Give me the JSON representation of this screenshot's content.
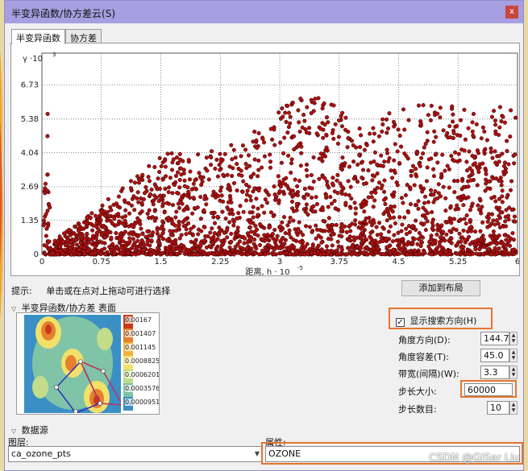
{
  "dialog": {
    "title": "半变异函数/协方差云(S)",
    "close_glyph": "x",
    "tabs": [
      "半变异函数",
      "协方差"
    ]
  },
  "chart_data": {
    "type": "scatter",
    "title": "",
    "y_axis_label": "γ ·10",
    "y_axis_exponent": "3",
    "x_axis_label": "距离, h · 10",
    "x_axis_exponent": "-5",
    "x_ticks": [
      "0",
      "0.75",
      "1.5",
      "2.25",
      "3",
      "3.75",
      "4.5",
      "5.25",
      "6"
    ],
    "y_ticks": [
      "0",
      "1.35",
      "2.69",
      "4.04",
      "5.38",
      "6.73"
    ],
    "xlim": [
      0,
      6
    ],
    "ylim": [
      0,
      8.0
    ],
    "grid": true,
    "point_color": "#b01010",
    "approx_upper_envelope": [
      {
        "x": 0.1,
        "y": 0.4
      },
      {
        "x": 0.5,
        "y": 1.4
      },
      {
        "x": 1.0,
        "y": 2.6
      },
      {
        "x": 1.5,
        "y": 4.0
      },
      {
        "x": 2.0,
        "y": 4.2
      },
      {
        "x": 2.5,
        "y": 4.4
      },
      {
        "x": 3.0,
        "y": 5.8
      },
      {
        "x": 3.5,
        "y": 6.6
      },
      {
        "x": 4.0,
        "y": 5.0
      },
      {
        "x": 4.5,
        "y": 5.8
      },
      {
        "x": 5.0,
        "y": 6.1
      },
      {
        "x": 5.5,
        "y": 5.6
      },
      {
        "x": 6.0,
        "y": 6.3
      }
    ]
  },
  "hint": {
    "label": "提示:",
    "text": "单击或在点对上拖动可进行选择"
  },
  "add_to_layout_button": "添加到布局",
  "surface_section": {
    "header": "半变异函数/协方差 表面",
    "legend": [
      "0.00167",
      "0.001407",
      "0.001145",
      "0.0008825",
      "0.0006201",
      "0.0003576",
      "0.00009517"
    ],
    "legend_colors": [
      "#c83a18",
      "#e5802e",
      "#f0b43a",
      "#f3e06a",
      "#c2dc8a",
      "#7fc4a6",
      "#3a8fc4"
    ]
  },
  "search_params": {
    "show_direction_label": "显示搜索方向(H)",
    "show_direction_checked": true,
    "angle_label": "角度方向(D):",
    "angle_value": "144.7",
    "tolerance_label": "角度容差(T):",
    "tolerance_value": "45.0",
    "bandwidth_label": "带宽(间隔)(W):",
    "bandwidth_value": "3.3",
    "lag_size_label": "步长大小:",
    "lag_size_value": "60000",
    "lag_count_label": "步长数目:",
    "lag_count_value": "10"
  },
  "data_source": {
    "header": "数据源",
    "layer_label": "图层:",
    "layer_value": "ca_ozone_pts",
    "attribute_label": "属性:",
    "attribute_value": "OZONE"
  },
  "watermark": "CSDN @GISer Liu"
}
